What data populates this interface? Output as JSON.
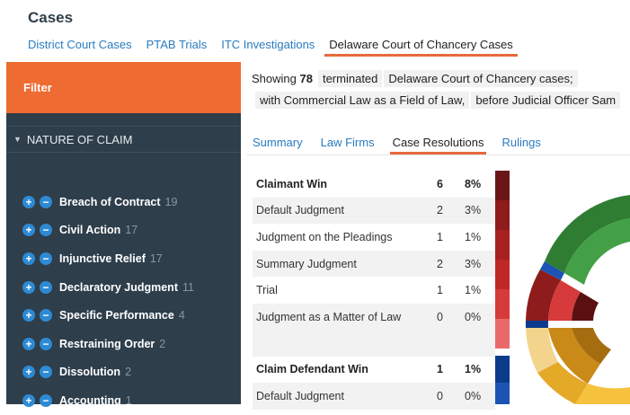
{
  "page": {
    "title": "Cases"
  },
  "top_tabs": [
    {
      "label": "District Court Cases"
    },
    {
      "label": "PTAB Trials"
    },
    {
      "label": "ITC Investigations"
    },
    {
      "label": "Delaware Court of Chancery Cases",
      "active": true
    }
  ],
  "sidebar": {
    "filter_label": "Filter",
    "section_label": "NATURE OF CLAIM",
    "claims": [
      {
        "label": "Breach of Contract",
        "count": "19"
      },
      {
        "label": "Civil Action",
        "count": "17"
      },
      {
        "label": "Injunctive Relief",
        "count": "17"
      },
      {
        "label": "Declaratory Judgment",
        "count": "11"
      },
      {
        "label": "Specific Performance",
        "count": "4"
      },
      {
        "label": "Restraining Order",
        "count": "2"
      },
      {
        "label": "Dissolution",
        "count": "2"
      },
      {
        "label": "Accounting",
        "count": "1"
      }
    ]
  },
  "summary": {
    "showing_prefix": "Showing",
    "count": "78",
    "status": "terminated",
    "court": "Delaware Court of Chancery cases;",
    "field_of_law": "with Commercial Law as a Field of Law,",
    "judge": "before Judicial Officer Sam"
  },
  "sub_tabs": [
    {
      "label": "Summary"
    },
    {
      "label": "Law Firms"
    },
    {
      "label": "Case Resolutions",
      "active": true
    },
    {
      "label": "Rulings"
    }
  ],
  "resolutions": {
    "claimant_win": {
      "label": "Claimant Win",
      "count": "6",
      "pct": "8%",
      "rows": [
        {
          "label": "Default Judgment",
          "count": "2",
          "pct": "3%"
        },
        {
          "label": "Judgment on the Pleadings",
          "count": "1",
          "pct": "1%"
        },
        {
          "label": "Summary Judgment",
          "count": "2",
          "pct": "3%"
        },
        {
          "label": "Trial",
          "count": "1",
          "pct": "1%"
        },
        {
          "label": "Judgment as a Matter of Law",
          "count": "0",
          "pct": "0%"
        }
      ]
    },
    "claim_defendant_win": {
      "label": "Claim Defendant Win",
      "count": "1",
      "pct": "1%",
      "rows": [
        {
          "label": "Default Judgment",
          "count": "0",
          "pct": "0%"
        }
      ]
    }
  },
  "colors": {
    "accent": "#ee6b32",
    "sidebar_bg": "#2e3e4b",
    "link": "#2a7bc0",
    "claimant_bar": [
      "#6b1616",
      "#8e1c1c",
      "#a82121",
      "#c02727",
      "#d63a3a",
      "#ea6a6a"
    ],
    "defendant_bar": [
      "#0d3b8c",
      "#1c54b3"
    ]
  }
}
